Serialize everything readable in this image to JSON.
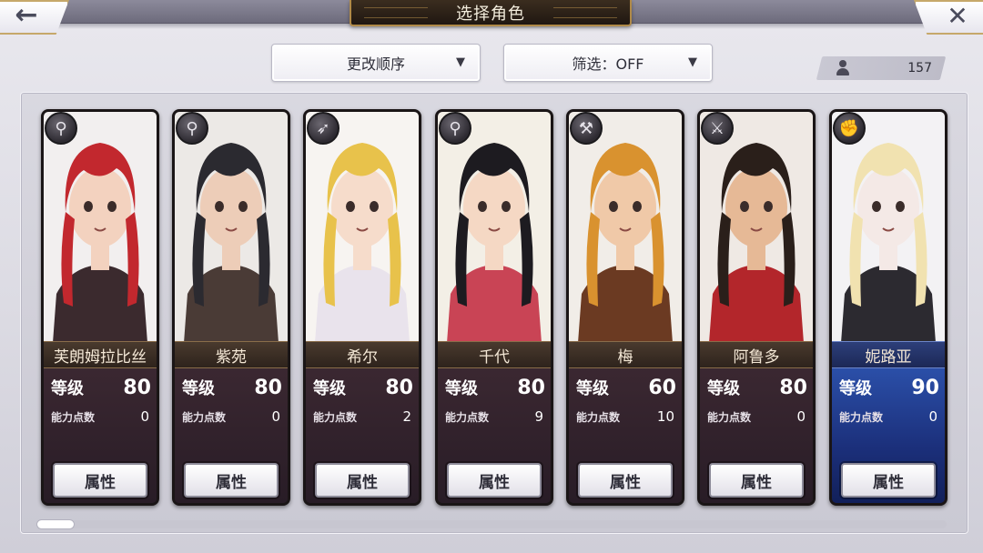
{
  "header": {
    "title": "选择角色",
    "back_icon": "←",
    "close_icon": "✕"
  },
  "toolbar": {
    "sort_label": "更改顺序",
    "filter_label": "筛选：OFF",
    "dropdown_arrow": "▼",
    "character_count": "157"
  },
  "characters": [
    {
      "name": "芙朗姆拉比丝",
      "level_label": "等级",
      "level": "80",
      "points_label": "能力点数",
      "points": "0",
      "button": "属性",
      "class_icon": "rod-icon",
      "class_glyph": "⚲",
      "hair": "#c2282e",
      "skin": "#f3d2bf",
      "outfit": "#3b2a2e",
      "bg": "#f2efef"
    },
    {
      "name": "紫苑",
      "level_label": "等级",
      "level": "80",
      "points_label": "能力点数",
      "points": "0",
      "button": "属性",
      "class_icon": "rod-icon",
      "class_glyph": "⚲",
      "hair": "#2b2a30",
      "skin": "#edcdb8",
      "outfit": "#4a3b36",
      "bg": "#ece9e6"
    },
    {
      "name": "希尔",
      "level_label": "等级",
      "level": "80",
      "points_label": "能力点数",
      "points": "2",
      "button": "属性",
      "class_icon": "bow-icon",
      "class_glyph": "➶",
      "hair": "#e8c24b",
      "skin": "#f6dccb",
      "outfit": "#e9e3ec",
      "bg": "#f7f4f1"
    },
    {
      "name": "千代",
      "level_label": "等级",
      "level": "80",
      "points_label": "能力点数",
      "points": "9",
      "button": "属性",
      "class_icon": "rod-icon",
      "class_glyph": "⚲",
      "hair": "#1d1b20",
      "skin": "#f5d8c4",
      "outfit": "#c94455",
      "bg": "#f3efe6"
    },
    {
      "name": "梅",
      "level_label": "等级",
      "level": "60",
      "points_label": "能力点数",
      "points": "10",
      "button": "属性",
      "class_icon": "hammer-icon",
      "class_glyph": "⚒",
      "hair": "#d9922f",
      "skin": "#f0c9a8",
      "outfit": "#6b3a22",
      "bg": "#f1ede8"
    },
    {
      "name": "阿鲁多",
      "level_label": "等级",
      "level": "80",
      "points_label": "能力点数",
      "points": "0",
      "button": "属性",
      "class_icon": "sword-icon",
      "class_glyph": "⚔",
      "hair": "#2a1f1a",
      "skin": "#e6b996",
      "outfit": "#b3262b",
      "bg": "#efe9e4"
    },
    {
      "name": "妮路亚",
      "level_label": "等级",
      "level": "90",
      "points_label": "能力点数",
      "points": "0",
      "button": "属性",
      "class_icon": "fist-icon",
      "class_glyph": "✊",
      "hair": "#f1e2b0",
      "skin": "#f4e9e6",
      "outfit": "#2c2a30",
      "bg": "#f3f2f4"
    }
  ],
  "colors": {
    "accent_gold": "#b08a48",
    "highlight_blue": "#2b4fa8"
  }
}
